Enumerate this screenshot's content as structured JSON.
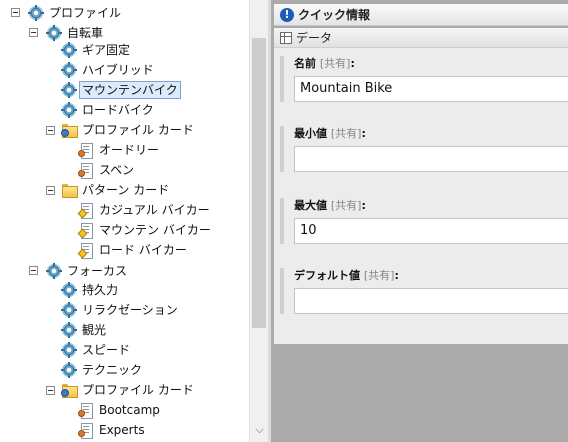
{
  "tree": {
    "items": [
      {
        "label": "プロファイル",
        "icon": "gear-icon"
      },
      {
        "label": "自転車",
        "icon": "gear-icon"
      },
      {
        "label": "ギア固定",
        "icon": "gear-icon"
      },
      {
        "label": "ハイブリッド",
        "icon": "gear-icon"
      },
      {
        "label": "マウンテンバイク",
        "icon": "gear-icon",
        "selected": true
      },
      {
        "label": "ロードバイク",
        "icon": "gear-icon"
      },
      {
        "label": "プロファイル カード",
        "icon": "folder-users-icon"
      },
      {
        "label": "オードリー",
        "icon": "person-card-icon"
      },
      {
        "label": "スベン",
        "icon": "person-card-icon"
      },
      {
        "label": "パターン カード",
        "icon": "folder-icon"
      },
      {
        "label": "カジュアル バイカー",
        "icon": "pattern-card-icon"
      },
      {
        "label": "マウンテン バイカー",
        "icon": "pattern-card-icon"
      },
      {
        "label": "ロード バイカー",
        "icon": "pattern-card-icon"
      },
      {
        "label": "フォーカス",
        "icon": "gear-icon"
      },
      {
        "label": "持久力",
        "icon": "gear-icon"
      },
      {
        "label": "リラクゼーション",
        "icon": "gear-icon"
      },
      {
        "label": "観光",
        "icon": "gear-icon"
      },
      {
        "label": "スピード",
        "icon": "gear-icon"
      },
      {
        "label": "テクニック",
        "icon": "gear-icon"
      },
      {
        "label": "プロファイル カード",
        "icon": "folder-users-icon"
      },
      {
        "label": "Bootcamp",
        "icon": "person-card-icon"
      },
      {
        "label": "Experts",
        "icon": "person-card-icon"
      }
    ]
  },
  "quick_info": {
    "title": "クイック情報",
    "icon": "info-icon"
  },
  "section": {
    "title": "データ",
    "icon": "data-section-icon"
  },
  "fields": {
    "name": {
      "label": "名前",
      "shared": "[共有]",
      "colon": ":",
      "value": "Mountain Bike"
    },
    "min": {
      "label": "最小値",
      "shared": "[共有]",
      "colon": ":",
      "value": ""
    },
    "max": {
      "label": "最大値",
      "shared": "[共有]",
      "colon": ":",
      "value": "10"
    },
    "default": {
      "label": "デフォルト値",
      "shared": "[共有]",
      "colon": ":",
      "value": ""
    }
  },
  "scrollbar": {
    "down_glyph": "⌵"
  }
}
